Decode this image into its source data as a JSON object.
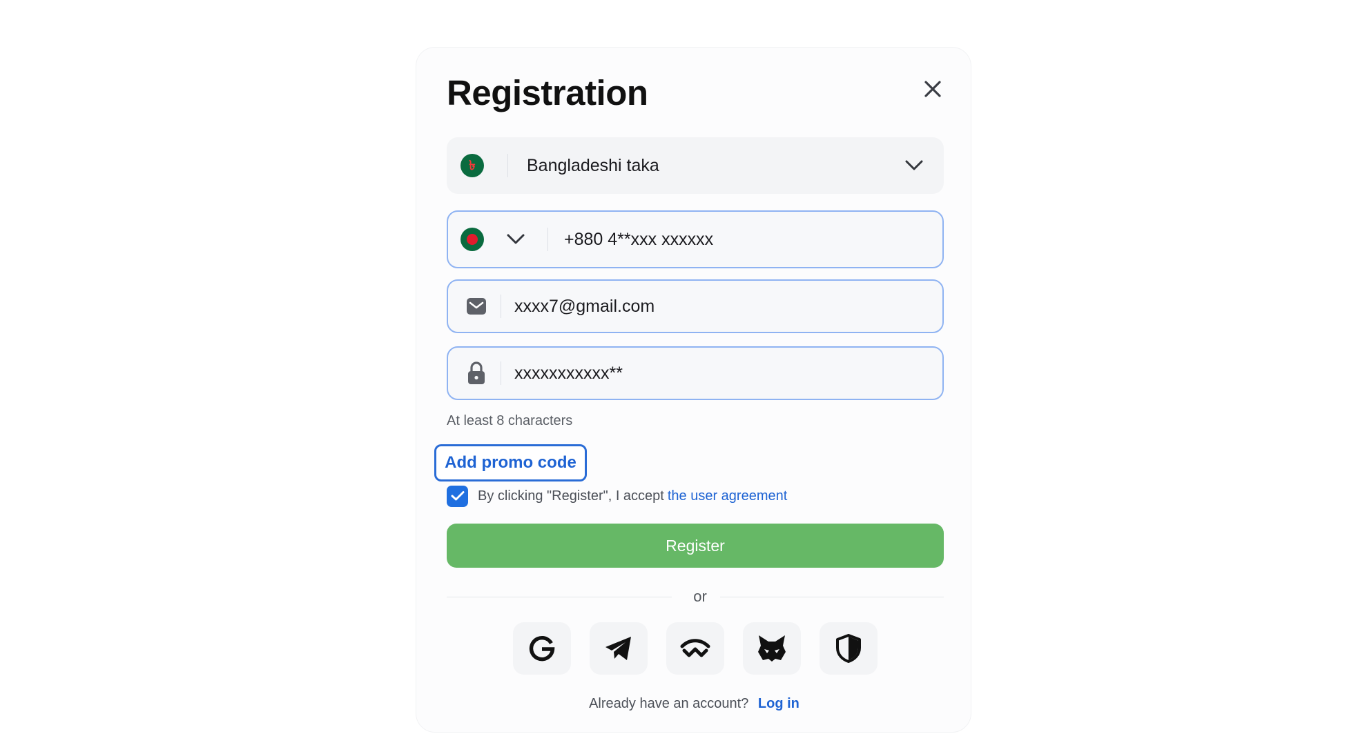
{
  "modal": {
    "title": "Registration"
  },
  "currency": {
    "symbol": "৳",
    "value": "Bangladeshi taka"
  },
  "phone": {
    "value": "+880 4**xxx xxxxxx"
  },
  "email": {
    "value": "xxxx7@gmail.com"
  },
  "password": {
    "value": "xxxxxxxxxxx**",
    "hint": "At least 8 characters"
  },
  "promo": {
    "label": "Add promo code"
  },
  "agreement": {
    "checked": true,
    "text": "By clicking \"Register\", I accept",
    "link": "the user agreement"
  },
  "register": {
    "label": "Register"
  },
  "divider": {
    "text": "or"
  },
  "social": [
    {
      "icon": "google-icon"
    },
    {
      "icon": "telegram-icon"
    },
    {
      "icon": "walletconnect-icon"
    },
    {
      "icon": "metamask-icon"
    },
    {
      "icon": "shield-icon"
    }
  ],
  "login": {
    "question": "Already have an account?",
    "link": "Log in"
  },
  "colors": {
    "accent_blue": "#1e63d3",
    "register_green": "#66b866",
    "flag_green": "#0a6b3f",
    "flag_red": "#e21b2d"
  }
}
